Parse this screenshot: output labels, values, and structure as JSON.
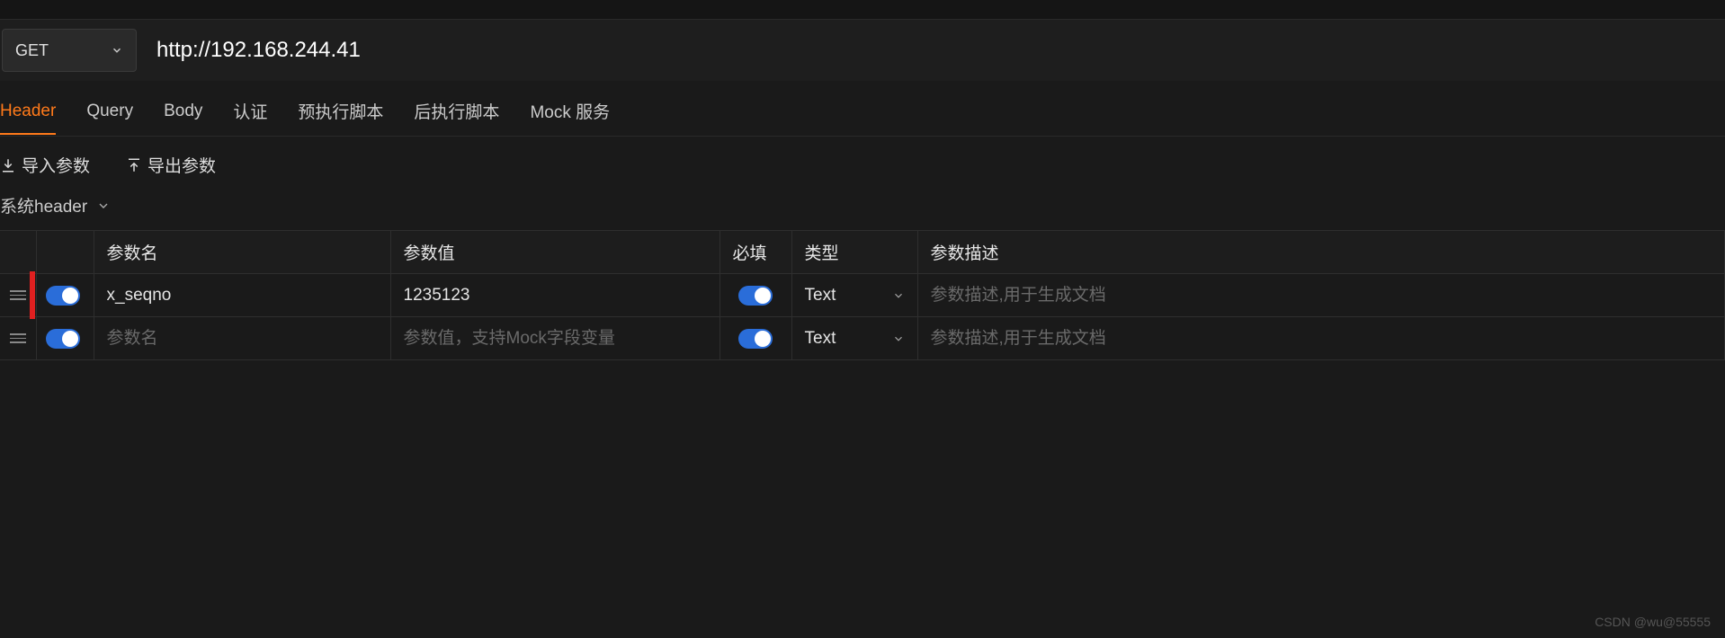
{
  "request": {
    "method": "GET",
    "url": "http://192.168.244.41"
  },
  "tabs": [
    {
      "label": "Header",
      "active": true
    },
    {
      "label": "Query",
      "active": false
    },
    {
      "label": "Body",
      "active": false
    },
    {
      "label": "认证",
      "active": false
    },
    {
      "label": "预执行脚本",
      "active": false
    },
    {
      "label": "后执行脚本",
      "active": false
    },
    {
      "label": "Mock 服务",
      "active": false
    }
  ],
  "actions": {
    "import": "导入参数",
    "export": "导出参数"
  },
  "section": {
    "label": "系统header"
  },
  "table": {
    "headers": {
      "name": "参数名",
      "value": "参数值",
      "required": "必填",
      "type": "类型",
      "desc": "参数描述"
    },
    "rows": [
      {
        "enabled": true,
        "name": "x_seqno",
        "value": "1235123",
        "required": true,
        "type": "Text",
        "desc": "",
        "highlight": true
      },
      {
        "enabled": true,
        "name": "",
        "value": "",
        "required": true,
        "type": "Text",
        "desc": "",
        "highlight": false
      }
    ],
    "placeholders": {
      "name": "参数名",
      "value": "参数值，支持Mock字段变量",
      "desc": "参数描述,用于生成文档"
    }
  },
  "watermark": "CSDN @wu@55555"
}
